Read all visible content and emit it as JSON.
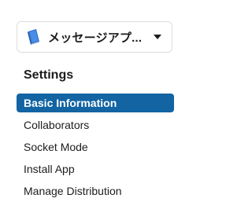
{
  "app_selector": {
    "name": "メッセージアプ...",
    "icon": "book-icon",
    "chevron_icon": "chevron-down-icon"
  },
  "settings": {
    "title": "Settings",
    "items": [
      {
        "label": "Basic Information",
        "active": true
      },
      {
        "label": "Collaborators",
        "active": false
      },
      {
        "label": "Socket Mode",
        "active": false
      },
      {
        "label": "Install App",
        "active": false
      },
      {
        "label": "Manage Distribution",
        "active": false
      }
    ]
  },
  "colors": {
    "active_bg": "#1264a3",
    "active_text": "#ffffff",
    "text": "#1d1c1d",
    "border": "#dddddd"
  }
}
